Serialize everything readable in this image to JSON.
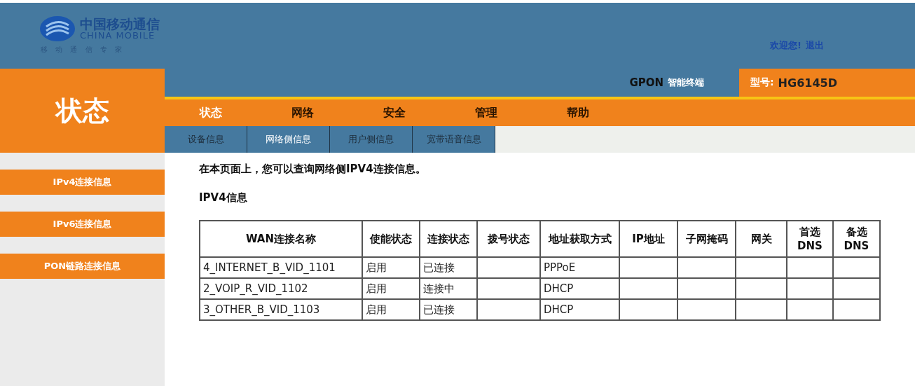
{
  "header": {
    "logo": {
      "name_cn": "中国移动通信",
      "name_en": "CHINA MOBILE",
      "slogan": "移 动 通 信 专 家"
    },
    "welcome": "欢迎您!",
    "logout": "退出"
  },
  "product": {
    "type": "GPON",
    "type_suffix": "智能终端",
    "model_label": "型号:",
    "model": "HG6145D"
  },
  "section_title": "状态",
  "nav": [
    {
      "label": "状态",
      "selected": true
    },
    {
      "label": "网络",
      "selected": false
    },
    {
      "label": "安全",
      "selected": false
    },
    {
      "label": "管理",
      "selected": false
    },
    {
      "label": "帮助",
      "selected": false
    }
  ],
  "subnav": [
    {
      "label": "设备信息",
      "selected": false
    },
    {
      "label": "网络侧信息",
      "selected": true
    },
    {
      "label": "用户侧信息",
      "selected": false
    },
    {
      "label": "宽带语音信息",
      "selected": false
    }
  ],
  "sidebar": {
    "items": [
      "IPv4连接信息",
      "IPv6连接信息",
      "PON链路连接信息"
    ]
  },
  "intro": "在本页面上，您可以查询网络侧IPV4连接信息。",
  "table_title": "IPV4信息",
  "table": {
    "columns": [
      "WAN连接名称",
      "使能状态",
      "连接状态",
      "拨号状态",
      "地址获取方式",
      "IP地址",
      "子网掩码",
      "网关",
      "首选 DNS",
      "备选 DNS"
    ],
    "rows": [
      [
        "4_INTERNET_B_VID_1101",
        "启用",
        "已连接",
        "",
        "PPPoE",
        "",
        "",
        "",
        "",
        ""
      ],
      [
        "2_VOIP_R_VID_1102",
        "启用",
        "连接中",
        "",
        "DHCP",
        "",
        "",
        "",
        "",
        ""
      ],
      [
        "3_OTHER_B_VID_1103",
        "启用",
        "已连接",
        "",
        "DHCP",
        "",
        "",
        "",
        "",
        ""
      ]
    ]
  }
}
